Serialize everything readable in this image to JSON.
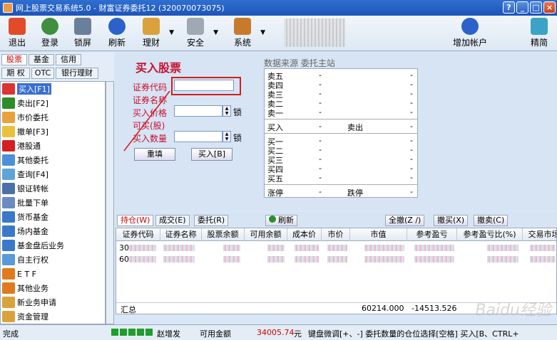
{
  "window": {
    "title": "网上股票交易系统5.0 - 财富证券委托12 (320070073075)"
  },
  "toolbar": {
    "exit": "退出",
    "login": "登录",
    "lock": "锁屏",
    "refresh": "刷新",
    "finance": "理财",
    "security": "安全",
    "system": "系统",
    "add_account": "增加帐户",
    "jingjian": "精简"
  },
  "left_tabs": {
    "row1": [
      "股票",
      "基金",
      "信用"
    ],
    "row2": [
      "期 权",
      "OTC",
      "银行理财"
    ]
  },
  "left_menu": [
    "买入[F1]",
    "卖出[F2]",
    "市价委托",
    "撤单[F3]",
    "港股通",
    "其他委托",
    "查询[F4]",
    "银证转帐",
    "批量下单",
    "货币基金",
    "场内基金",
    "基金盘后业务",
    "自主行权",
    "E T F",
    "其他业务",
    "新业务申请",
    "资金管理"
  ],
  "form": {
    "title": "买入股票",
    "code_label": "证券代码",
    "name_label": "证券名称",
    "price_label": "买入价格",
    "avail_label": "可买(股)",
    "qty_label": "买入数量",
    "lock": "锁",
    "reset_button": "重填",
    "buy_button": "买入[B]"
  },
  "quote": {
    "source": "数据来源 委托主站",
    "sells": [
      "卖五",
      "卖四",
      "卖三",
      "卖二",
      "卖一"
    ],
    "buys": [
      "买一",
      "买二",
      "买三",
      "买四",
      "买五"
    ],
    "dash": "-",
    "buy_label": "买入",
    "sell_label": "卖出",
    "limit_up": "涨停",
    "limit_down": "跌停"
  },
  "table_tabs": [
    "持仓(W)",
    "成交(E)",
    "委托(R)"
  ],
  "table_buttons": {
    "refresh": "刷新",
    "cancel_all": "全撤(Z /)",
    "cancel_buy": "撤买(X)",
    "cancel_sell": "撤卖(C)"
  },
  "table": {
    "columns": [
      "证券代码",
      "证券名称",
      "股票余额",
      "可用余额",
      "成本价",
      "市价",
      "市值",
      "参考盈亏",
      "参考盈亏比(%)",
      "交易市场"
    ],
    "rows": [
      {
        "code": "30"
      },
      {
        "code": "60"
      }
    ],
    "summary": {
      "label": "汇总",
      "market_value": "60214.000",
      "profit": "-14513.526"
    }
  },
  "status": {
    "left": "完成",
    "user": "赵增发",
    "available_label": "可用金额",
    "available_value": "34005.74",
    "currency": "元",
    "hint": "键盘微调[+、-] 委托数量的仓位选择[空格] 买入[B、CTRL+"
  },
  "watermark": "Baidu经验"
}
